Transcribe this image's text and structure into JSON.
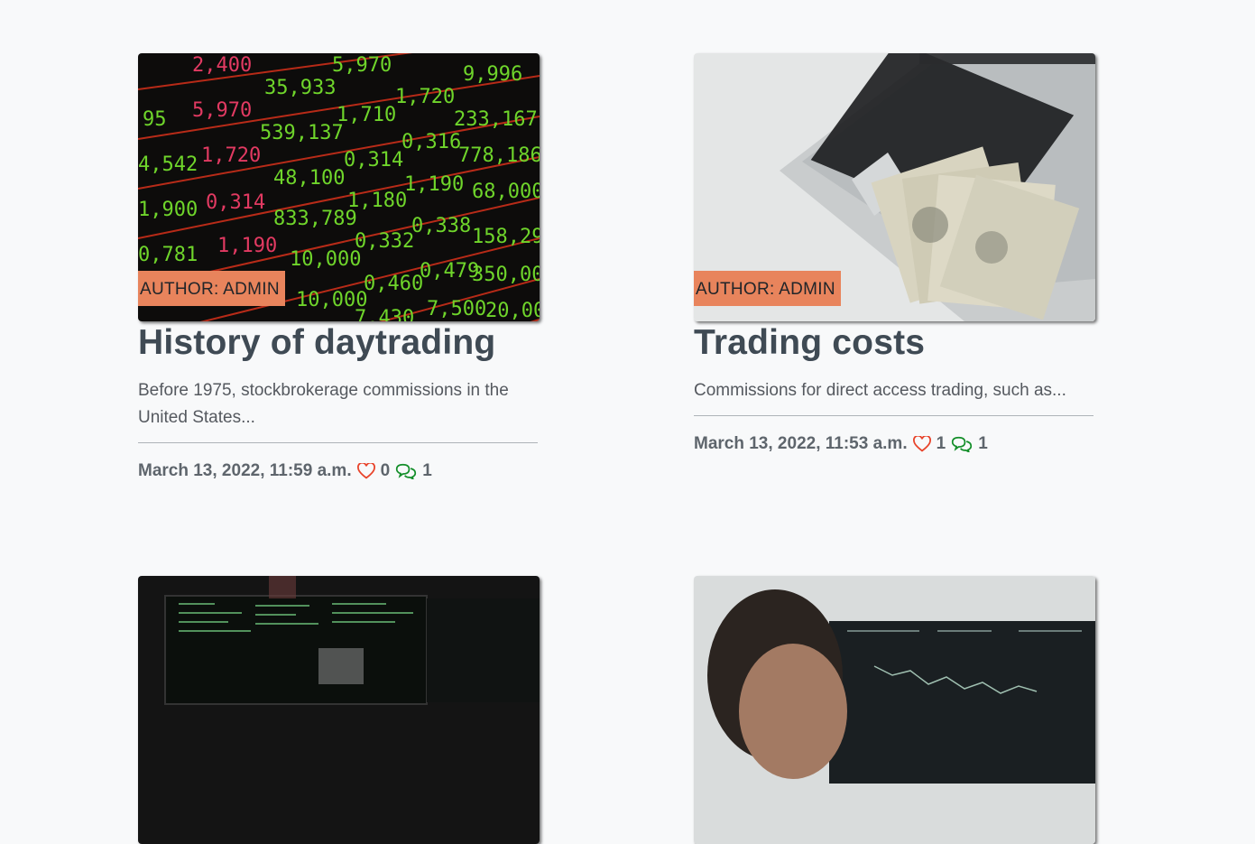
{
  "posts": [
    {
      "author_badge": "AUTHOR: ADMIN",
      "title": "History of daytrading",
      "excerpt": "Before 1975, stockbrokerage commissions in the United States...",
      "date": "March 13, 2022, 11:59 a.m.",
      "likes": "0",
      "comments": "1",
      "image": "stock-ticker-board"
    },
    {
      "author_badge": "AUTHOR: ADMIN",
      "title": "Trading costs",
      "excerpt": "Commissions for direct access trading, such as...",
      "date": "March 13, 2022, 11:53 a.m.",
      "likes": "1",
      "comments": "1",
      "image": "laptop-with-cash"
    },
    {
      "image": "terminal-screens"
    },
    {
      "image": "trader-at-monitor"
    }
  ],
  "icons": {
    "like": "heart-icon",
    "comment": "comments-icon"
  },
  "colors": {
    "badge": "#e8845c",
    "heart": "#e8442b",
    "comment": "#138e29"
  }
}
